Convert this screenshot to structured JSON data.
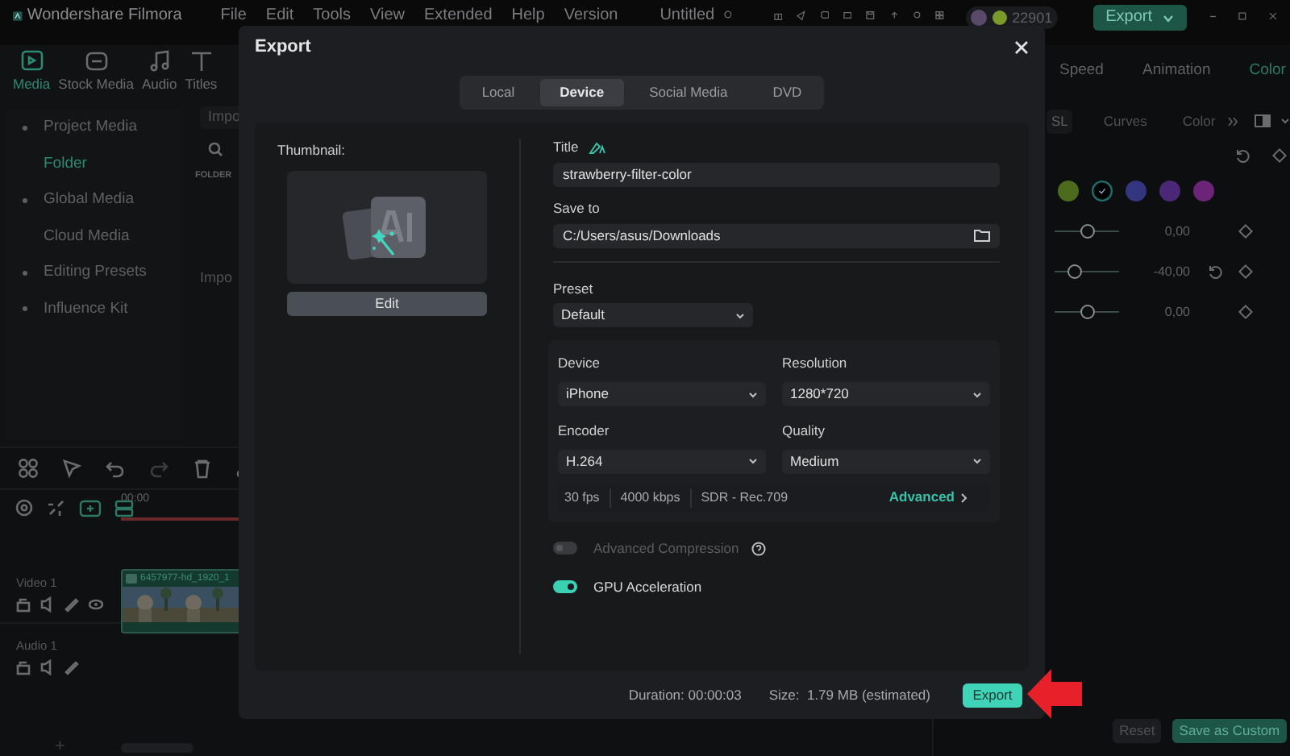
{
  "app": {
    "logo": "Wondershare Filmora",
    "menu": [
      "File",
      "Edit",
      "Tools",
      "View",
      "Extended",
      "Help",
      "Version"
    ],
    "project": "Untitled",
    "credits": "22901",
    "export_button": "Export"
  },
  "media_tabs": [
    {
      "label": "Media",
      "selected": true
    },
    {
      "label": "Stock Media",
      "selected": false
    },
    {
      "label": "Audio",
      "selected": false
    },
    {
      "label": "Titles",
      "selected": false
    }
  ],
  "sidebar": [
    {
      "label": "Project Media",
      "selected": false,
      "children": [
        {
          "label": "Folder",
          "selected": true
        }
      ]
    },
    {
      "label": "Global Media",
      "selected": false,
      "children": [
        {
          "label": "Cloud Media",
          "selected": false
        }
      ]
    },
    {
      "label": "Editing Presets",
      "selected": false
    },
    {
      "label": "Influence Kit",
      "selected": false
    }
  ],
  "media_browser": {
    "import_button": "Impo",
    "folder_heading": "FOLDER",
    "import_hint": "Impo"
  },
  "timeline": {
    "time": "00:00",
    "tracks": [
      {
        "name": "Video 1",
        "kind": "video"
      },
      {
        "name": "Audio 1",
        "kind": "audio"
      }
    ],
    "clip": "6457977-hd_1920_1",
    "add_button": "+"
  },
  "property_tabs": [
    {
      "label": "Speed",
      "selected": false
    },
    {
      "label": "Animation",
      "selected": false
    },
    {
      "label": "Color",
      "selected": true
    }
  ],
  "color_tabs": [
    {
      "label": "SL",
      "selected": true
    },
    {
      "label": "Curves",
      "selected": false
    },
    {
      "label": "Color",
      "selected": false
    }
  ],
  "swatches": [
    {
      "color": "#4d6b1c",
      "selected": false
    },
    {
      "color": "#1f6e6e",
      "selected": true
    },
    {
      "color": "#33357f",
      "selected": false
    },
    {
      "color": "#4b2877",
      "selected": false
    },
    {
      "color": "#6c2478",
      "selected": false
    }
  ],
  "sliders": [
    {
      "level": 0.5,
      "reading": "0,00",
      "reset": false
    },
    {
      "level": 0.3,
      "reading": "-40,00",
      "reset": true
    },
    {
      "level": 0.5,
      "reading": "0,00",
      "reset": false
    }
  ],
  "panel_buttons": [
    {
      "label": "Reset",
      "kind": "plain"
    },
    {
      "label": "Save as Custom",
      "kind": "primary"
    }
  ],
  "dialog": {
    "title": "Export",
    "tabs": [
      {
        "label": "Local",
        "selected": false
      },
      {
        "label": "Device",
        "selected": true
      },
      {
        "label": "Social Media",
        "selected": false
      },
      {
        "label": "DVD",
        "selected": false
      }
    ],
    "thumbnail_label": "Thumbnail:",
    "edit_button": "Edit",
    "title_label": "Title",
    "title_value": "strawberry-filter-color",
    "save_label": "Save to",
    "save_value": "C:/Users/asus/Downloads",
    "preset_label": "Preset",
    "preset_value": "Default",
    "settings": [
      {
        "label": "Device",
        "value": "iPhone"
      },
      {
        "label": "Resolution",
        "value": "1280*720"
      },
      {
        "label": "Encoder",
        "value": "H.264"
      },
      {
        "label": "Quality",
        "value": "Medium"
      }
    ],
    "specs": [
      "30 fps",
      "4000 kbps",
      "SDR - Rec.709"
    ],
    "advanced_link": "Advanced",
    "toggles": [
      {
        "label": "Advanced Compression",
        "on": false,
        "disabled": true,
        "help": true
      },
      {
        "label": "GPU Acceleration",
        "on": true,
        "disabled": false,
        "help": false
      }
    ],
    "duration": "Duration: 00:00:03",
    "size": "Size:  1.79 MB (estimated)",
    "export_button": "Export"
  }
}
